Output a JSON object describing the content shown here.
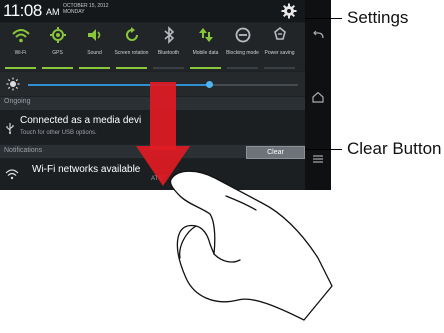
{
  "status_bar": {
    "time": "11:08",
    "ampm": "AM",
    "date_line1": "OCTOBER 15, 2012",
    "date_line2": "MONDAY"
  },
  "quick_settings": [
    {
      "label": "Wi-Fi",
      "icon": "wifi-icon",
      "on": true
    },
    {
      "label": "GPS",
      "icon": "gps-icon",
      "on": true
    },
    {
      "label": "Sound",
      "icon": "sound-icon",
      "on": true
    },
    {
      "label": "Screen rotation",
      "icon": "screen-rotation-icon",
      "on": true
    },
    {
      "label": "Bluetooth",
      "icon": "bluetooth-icon",
      "on": false
    },
    {
      "label": "Mobile data",
      "icon": "mobile-data-icon",
      "on": true
    },
    {
      "label": "Blocking mode",
      "icon": "blocking-mode-icon",
      "on": false
    },
    {
      "label": "Power saving",
      "icon": "power-saving-icon",
      "on": false
    }
  ],
  "brightness": {
    "level": 0.67
  },
  "ongoing": {
    "header": "Ongoing",
    "title": "Connected as a media devi",
    "subtitle": "Touch for other USB options."
  },
  "notifications": {
    "header": "Notifications",
    "clear_label": "Clear",
    "wifi_title": "Wi-Fi networks available",
    "wifi_sub": "AT&T"
  },
  "callouts": {
    "settings": "Settings",
    "clear": "Clear Button"
  },
  "colors": {
    "accent_on": "#8ac63a",
    "brightness": "#2f8fd0",
    "arrow": "#e01b24"
  }
}
